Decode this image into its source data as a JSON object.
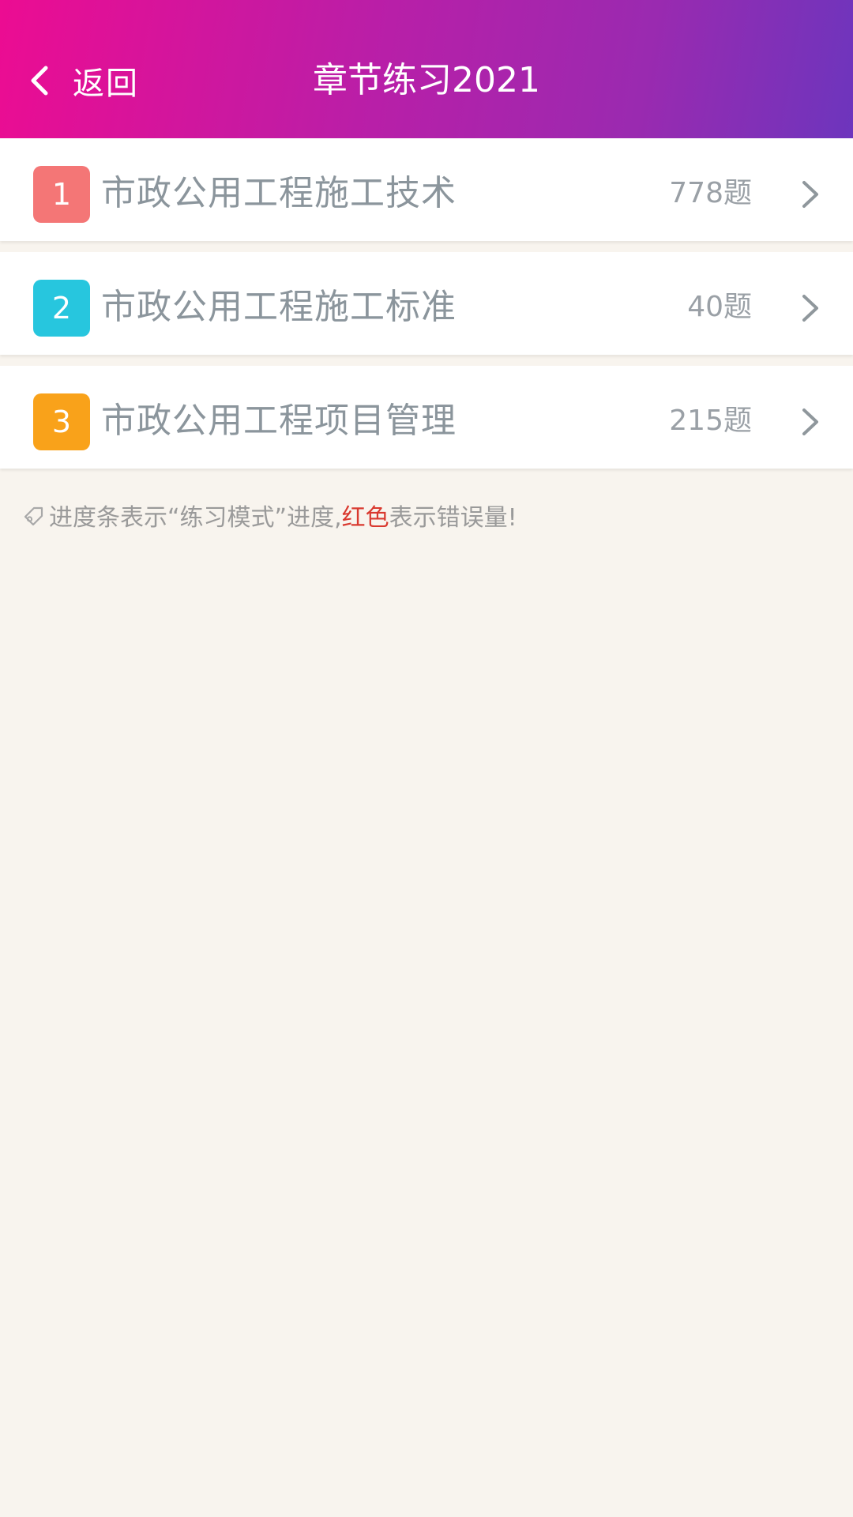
{
  "header": {
    "back_label": "返回",
    "title": "章节练习2021",
    "gradient_start": "#ec0c92",
    "gradient_end": "#6d35bd"
  },
  "chapters": [
    {
      "index": "1",
      "title": "市政公用工程施工技术",
      "count": "778题",
      "badge_color": "#f47676"
    },
    {
      "index": "2",
      "title": "市政公用工程施工标准",
      "count": "40题",
      "badge_color": "#27c6de"
    },
    {
      "index": "3",
      "title": "市政公用工程项目管理",
      "count": "215题",
      "badge_color": "#f9a21a"
    }
  ],
  "hint": {
    "icon": "tag-icon",
    "text_before": "进度条表示“练习模式”进度,",
    "text_red": "红色",
    "text_after": "表示错误量!",
    "red_color": "#d9392f"
  }
}
